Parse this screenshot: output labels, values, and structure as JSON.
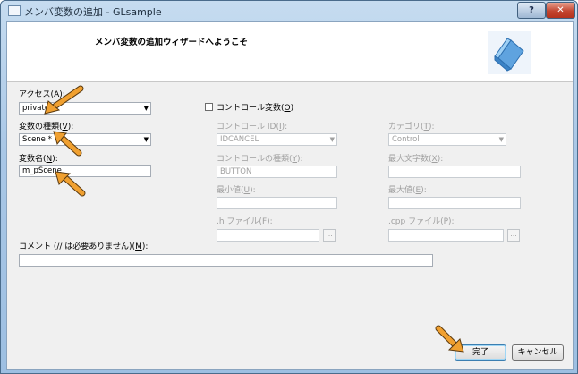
{
  "window": {
    "title": "メンバ変数の追加 - GLsample",
    "help_label": "?",
    "close_label": "✕"
  },
  "banner": {
    "title": "メンバ変数の追加ウィザードへようこそ",
    "icon": "blue-cube-icon"
  },
  "access": {
    "label": "アクセス(",
    "accel": "A",
    "label_end": "):",
    "value": "private"
  },
  "var_type": {
    "label": "変数の種類(",
    "accel": "V",
    "label_end": "):",
    "value": "Scene *"
  },
  "var_name": {
    "label": "変数名(",
    "accel": "N",
    "label_end": "):",
    "value": "m_pScene"
  },
  "control_var": {
    "label": "コントロール変数(",
    "accel": "O",
    "label_end": ")",
    "checked": false
  },
  "control_id": {
    "label": "コントロール ID(",
    "accel": "I",
    "label_end": "):",
    "value": "IDCANCEL"
  },
  "category": {
    "label": "カテゴリ(",
    "accel": "T",
    "label_end": "):",
    "value": "Control"
  },
  "control_type": {
    "label": "コントロールの種類(",
    "accel": "Y",
    "label_end": "):",
    "value": "BUTTON"
  },
  "max_chars": {
    "label": "最大文字数(",
    "accel": "X",
    "label_end": "):",
    "value": ""
  },
  "min_value": {
    "label": "最小値(",
    "accel": "U",
    "label_end": "):",
    "value": ""
  },
  "max_value": {
    "label": "最大値(",
    "accel": "E",
    "label_end": "):",
    "value": ""
  },
  "h_file": {
    "label": ".h ファイル(",
    "accel": "F",
    "label_end": "):",
    "value": "",
    "browse_label": "..."
  },
  "cpp_file": {
    "label": ".cpp ファイル(",
    "accel": "P",
    "label_end": "):",
    "value": "",
    "browse_label": "..."
  },
  "comment": {
    "label": "コメント (// は必要ありません)(",
    "accel": "M",
    "label_end": "):",
    "value": ""
  },
  "buttons": {
    "finish": "完了",
    "cancel": "キャンセル"
  },
  "colors": {
    "annotation_arrow": "#f0a030",
    "title_bar": "#a9c7e6",
    "close_button": "#c3452f"
  }
}
